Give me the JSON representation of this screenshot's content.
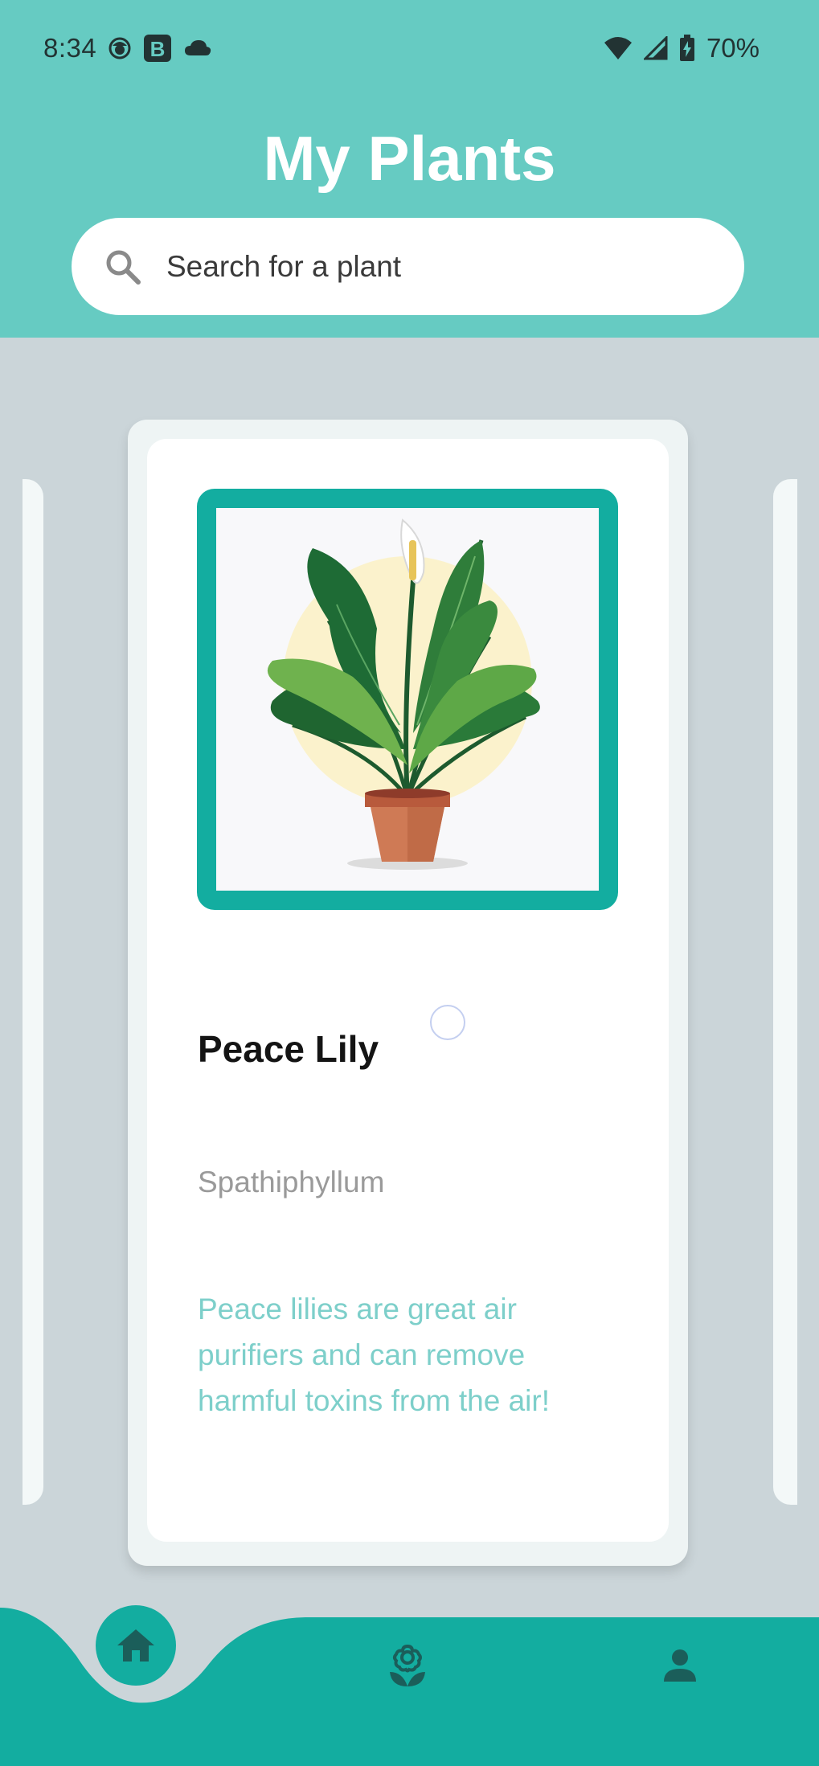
{
  "status_bar": {
    "time": "8:34",
    "battery_pct": "70%",
    "icons": [
      "face-notification-icon",
      "b-app-icon",
      "cloud-icon",
      "wifi-icon",
      "cell-signal-icon",
      "battery-charging-icon"
    ]
  },
  "header": {
    "title": "My Plants",
    "background_color": "#66cbc2"
  },
  "search": {
    "placeholder": "Search for a plant",
    "icon": "search-icon"
  },
  "plant_card": {
    "name": "Peace Lily",
    "scientific_name": "Spathiphyllum",
    "fact": "Peace lilies are great air purifiers and can remove harmful toxins from the air!",
    "frame_color": "#13ada0",
    "fact_color": "#7dcfca"
  },
  "bottom_nav": {
    "background_color": "#13ada0",
    "items": [
      {
        "icon": "home-icon",
        "active": true
      },
      {
        "icon": "flower-icon",
        "active": false
      },
      {
        "icon": "person-icon",
        "active": false
      }
    ]
  }
}
